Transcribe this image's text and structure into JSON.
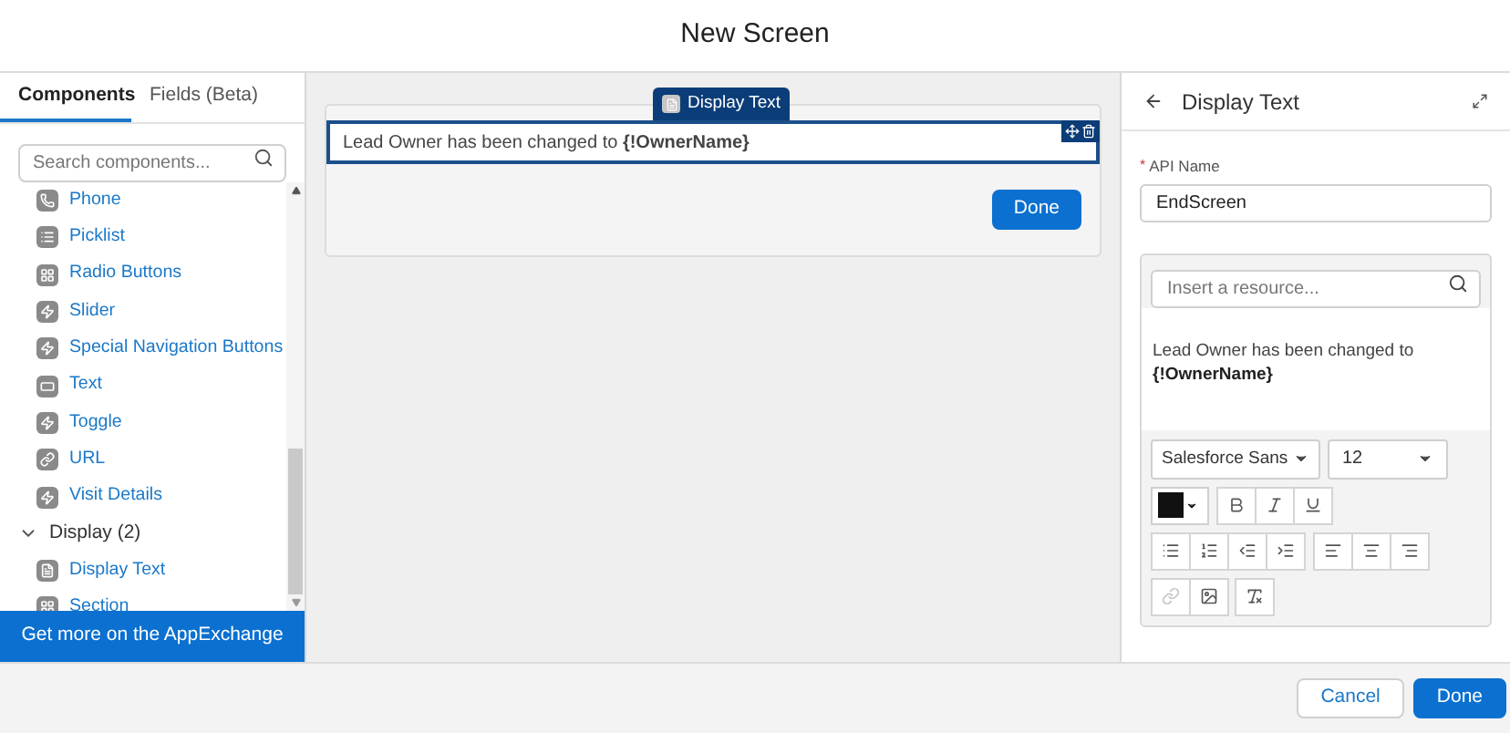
{
  "window": {
    "title": "New Screen"
  },
  "sidebar": {
    "tabs": [
      {
        "label": "Components",
        "selected": true
      },
      {
        "label": "Fields (Beta)",
        "selected": false
      }
    ],
    "search": {
      "placeholder": "Search components..."
    },
    "items": [
      {
        "label": "Phone",
        "kind": "phone"
      },
      {
        "label": "Picklist",
        "kind": "list"
      },
      {
        "label": "Radio Buttons",
        "kind": "grid"
      },
      {
        "label": "Slider",
        "kind": "bolt"
      },
      {
        "label": "Special Navigation Buttons",
        "kind": "bolt"
      },
      {
        "label": "Text",
        "kind": "field"
      },
      {
        "label": "Toggle",
        "kind": "bolt"
      },
      {
        "label": "URL",
        "kind": "link"
      },
      {
        "label": "Visit Details",
        "kind": "bolt"
      }
    ],
    "groups": [
      {
        "label": "Display (2)",
        "expanded": true,
        "children": [
          {
            "label": "Display Text",
            "kind": "doc"
          },
          {
            "label": "Section",
            "kind": "grid"
          }
        ]
      }
    ],
    "footer_link": "Get more on the AppExchange"
  },
  "canvas": {
    "tag": "Display Text",
    "text": "Lead Owner has been changed to **{!OwnerName}**",
    "done": "Done"
  },
  "panel": {
    "title": "Display Text",
    "api_required": "*",
    "api_label": "API Name",
    "api_value": "EndScreen",
    "resource": {
      "placeholder": "Insert a resource..."
    },
    "body": "Lead Owner has been changed to",
    "body_bold": "{!OwnerName}",
    "font": "Salesforce Sans",
    "size": "12",
    "color_picker": {
      "color": "#111111"
    },
    "link_disabled": true
  },
  "footer": {
    "buttons": [
      {
        "label": "Cancel",
        "kind": "neutral"
      },
      {
        "label": "Done",
        "kind": "brand"
      }
    ]
  }
}
